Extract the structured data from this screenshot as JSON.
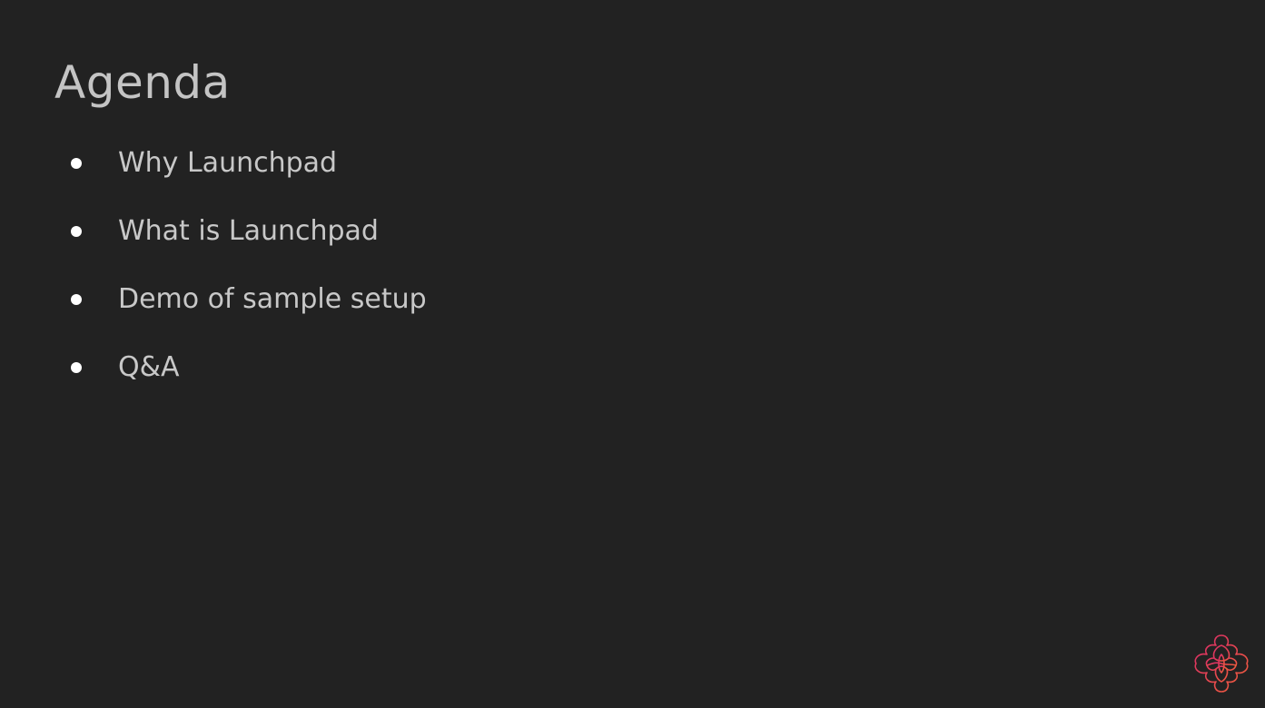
{
  "slide": {
    "title": "Agenda",
    "items": [
      {
        "label": "Why Launchpad"
      },
      {
        "label": "What is Launchpad"
      },
      {
        "label": "Demo of sample setup"
      },
      {
        "label": "Q&A"
      }
    ]
  },
  "colors": {
    "background": "#222222",
    "text": "#c8c8c8",
    "bullet": "#ffffff",
    "logo_start": "#e8355f",
    "logo_end": "#f05a3c"
  },
  "logo": {
    "icon": "knot-logo-icon"
  }
}
